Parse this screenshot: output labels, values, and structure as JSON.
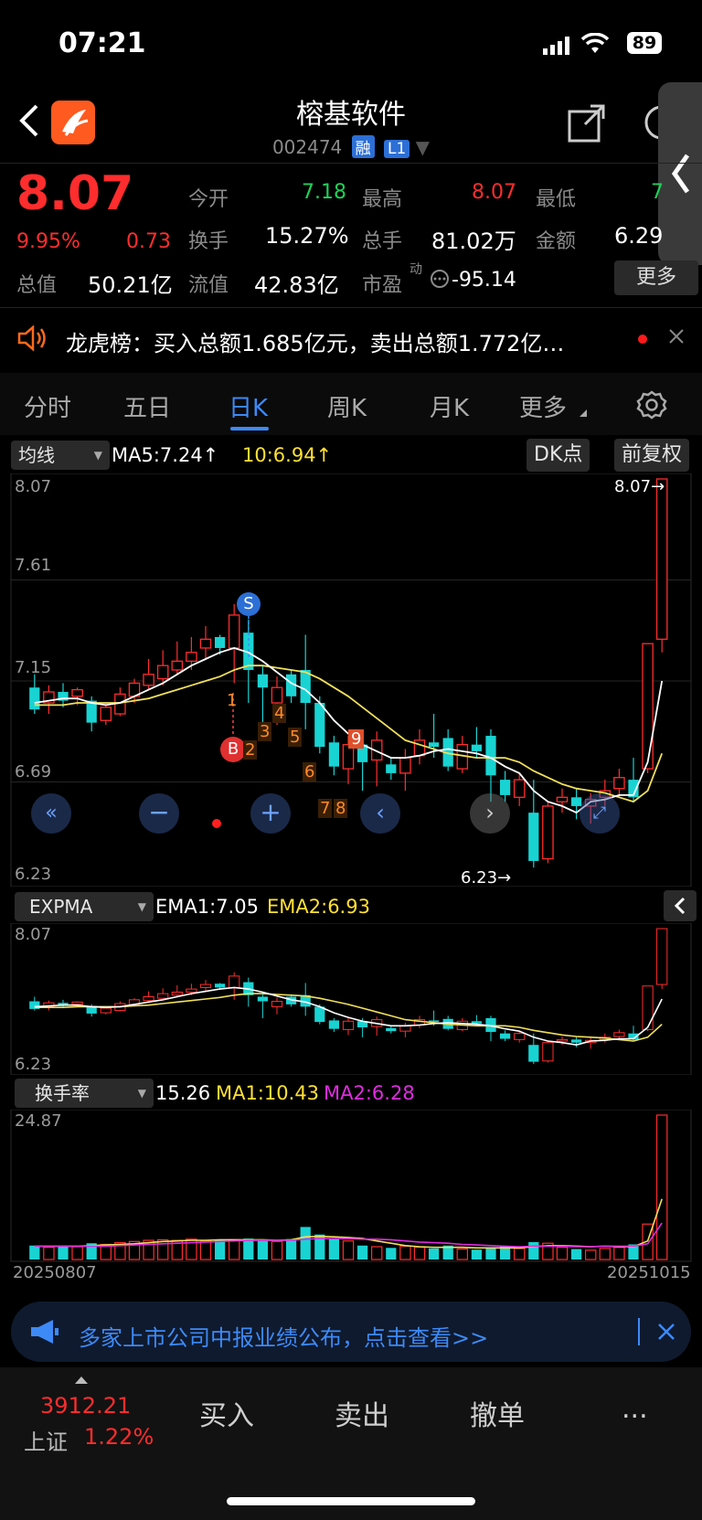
{
  "status_bar": {
    "time": "07:21",
    "battery": "89"
  },
  "header": {
    "title": "榕基软件",
    "code": "002474",
    "tag_rong": "融",
    "tag_l1": "L1",
    "back_icon": "chevron-left-icon",
    "share_icon": "share-icon",
    "search_icon": "search-icon",
    "side_tab_icon": "chevron-left-icon"
  },
  "quote": {
    "price": "8.07",
    "change_pct": "9.95%",
    "change": "0.73",
    "open_label": "今开",
    "open": "7.18",
    "high_label": "最高",
    "high": "8.07",
    "low_label": "最低",
    "low": "7",
    "turnover_label": "换手",
    "turnover": "15.27%",
    "volume_label": "总手",
    "volume": "81.02万",
    "amount_label": "金额",
    "amount": "6.29",
    "mcap_label": "总值",
    "mcap": "50.21亿",
    "float_label": "流值",
    "float": "42.83亿",
    "pe_label": "市盈",
    "pe_sup": "动",
    "pe": "-95.14",
    "more_label": "更多"
  },
  "news": {
    "text": "龙虎榜：买入总额1.685亿元，卖出总额1.772亿…",
    "speaker_icon": "speaker-icon",
    "close_icon": "close-icon"
  },
  "tabs": [
    {
      "label": "分时"
    },
    {
      "label": "五日"
    },
    {
      "label": "日K"
    },
    {
      "label": "周K"
    },
    {
      "label": "月K"
    },
    {
      "label": "更多"
    }
  ],
  "settings_icon": "gear-icon",
  "kline": {
    "ma_select": "均线",
    "ma5": "MA5:7.24↑",
    "ma10": "10:6.94↑",
    "dk_label": "DK点",
    "fq_label": "前复权",
    "y_labels": [
      "8.07",
      "7.61",
      "7.15",
      "6.69",
      "6.23"
    ],
    "max_label": "8.07→",
    "min_label": "6.23→",
    "signal_s": "S",
    "signal_b": "B",
    "counts": [
      "1",
      "2",
      "3",
      "4",
      "5",
      "6",
      "7",
      "8",
      "9"
    ]
  },
  "expma": {
    "select": "EXPMA",
    "ema1": "EMA1:7.05",
    "ema2": "EMA2:6.93",
    "y_top": "8.07",
    "y_bottom": "6.23"
  },
  "turnover_panel": {
    "select": "换手率",
    "value": "15.26",
    "ma1": "MA1:10.43",
    "ma2": "MA2:6.28",
    "y_top": "24.87",
    "date_start": "20250807",
    "date_end": "20251015"
  },
  "notice": {
    "text": "多家上市公司中报业绩公布，点击查看>>",
    "icon": "megaphone-icon",
    "close_icon": "close-icon"
  },
  "bottom": {
    "index_value": "3912.21",
    "index_name": "上证",
    "index_change": "1.22%",
    "buy": "买入",
    "sell": "卖出",
    "cancel": "撤单",
    "more": "..."
  },
  "colors": {
    "up": "#ff2d2d",
    "down": "#19d3d3",
    "accent": "#3d8af7",
    "ma5": "#ffffff",
    "ma10": "#f1e05a",
    "ma2": "#e02ce0"
  },
  "chart_data": {
    "type": "candlestick",
    "ylim": [
      6.23,
      8.07
    ],
    "candles": [
      [
        7.12,
        7.02,
        7.18,
        7.0
      ],
      [
        7.05,
        7.1,
        7.13,
        7.0
      ],
      [
        7.1,
        7.06,
        7.14,
        7.03
      ],
      [
        7.08,
        7.11,
        7.12,
        7.04
      ],
      [
        7.06,
        6.96,
        7.08,
        6.92
      ],
      [
        6.97,
        7.03,
        7.05,
        6.95
      ],
      [
        7.0,
        7.09,
        7.12,
        6.99
      ],
      [
        7.08,
        7.14,
        7.16,
        7.05
      ],
      [
        7.13,
        7.18,
        7.25,
        7.11
      ],
      [
        7.16,
        7.22,
        7.29,
        7.13
      ],
      [
        7.2,
        7.24,
        7.33,
        7.18
      ],
      [
        7.24,
        7.28,
        7.35,
        7.2
      ],
      [
        7.3,
        7.34,
        7.4,
        7.25
      ],
      [
        7.35,
        7.3,
        7.36,
        7.27
      ],
      [
        7.3,
        7.45,
        7.5,
        7.14
      ],
      [
        7.37,
        7.2,
        7.43,
        7.05
      ],
      [
        7.18,
        7.12,
        7.22,
        6.9
      ],
      [
        7.05,
        7.12,
        7.17,
        6.95
      ],
      [
        7.18,
        7.08,
        7.2,
        7.05
      ],
      [
        7.2,
        7.05,
        7.36,
        6.93
      ],
      [
        7.05,
        6.85,
        7.08,
        6.82
      ],
      [
        6.87,
        6.76,
        6.9,
        6.72
      ],
      [
        6.75,
        6.86,
        6.9,
        6.68
      ],
      [
        6.86,
        6.78,
        6.9,
        6.65
      ],
      [
        6.79,
        6.88,
        6.92,
        6.67
      ],
      [
        6.77,
        6.73,
        6.8,
        6.7
      ],
      [
        6.73,
        6.8,
        6.84,
        6.65
      ],
      [
        6.81,
        6.88,
        6.93,
        6.77
      ],
      [
        6.87,
        6.85,
        7.0,
        6.8
      ],
      [
        6.89,
        6.76,
        6.93,
        6.74
      ],
      [
        6.75,
        6.86,
        6.9,
        6.73
      ],
      [
        6.86,
        6.83,
        6.94,
        6.8
      ],
      [
        6.9,
        6.72,
        6.93,
        6.6
      ],
      [
        6.7,
        6.63,
        6.74,
        6.6
      ],
      [
        6.62,
        6.7,
        6.73,
        6.58
      ],
      [
        6.55,
        6.33,
        6.7,
        6.3
      ],
      [
        6.34,
        6.58,
        6.6,
        6.32
      ],
      [
        6.6,
        6.62,
        6.66,
        6.55
      ],
      [
        6.62,
        6.58,
        6.66,
        6.52
      ],
      [
        6.58,
        6.61,
        6.64,
        6.5
      ],
      [
        6.62,
        6.65,
        6.7,
        6.58
      ],
      [
        6.66,
        6.71,
        6.75,
        6.62
      ],
      [
        6.7,
        6.62,
        6.8,
        6.6
      ],
      [
        6.75,
        7.32,
        7.32,
        6.73
      ],
      [
        7.34,
        8.07,
        8.07,
        7.28
      ]
    ],
    "ma5": [
      7.05,
      7.06,
      7.07,
      7.07,
      7.05,
      7.04,
      7.05,
      7.08,
      7.11,
      7.14,
      7.18,
      7.22,
      7.25,
      7.28,
      7.3,
      7.28,
      7.24,
      7.19,
      7.14,
      7.11,
      7.05,
      6.97,
      6.91,
      6.86,
      6.83,
      6.8,
      6.8,
      6.81,
      6.83,
      6.84,
      6.83,
      6.82,
      6.8,
      6.76,
      6.73,
      6.65,
      6.6,
      6.58,
      6.55,
      6.6,
      6.61,
      6.63,
      6.63,
      6.78,
      7.15
    ],
    "ma10": [
      7.04,
      7.04,
      7.04,
      7.05,
      7.05,
      7.05,
      7.05,
      7.06,
      7.07,
      7.09,
      7.11,
      7.13,
      7.15,
      7.17,
      7.2,
      7.22,
      7.22,
      7.21,
      7.2,
      7.19,
      7.16,
      7.12,
      7.08,
      7.03,
      6.98,
      6.93,
      6.88,
      6.86,
      6.84,
      6.82,
      6.81,
      6.8,
      6.8,
      6.8,
      6.78,
      6.74,
      6.71,
      6.68,
      6.66,
      6.65,
      6.64,
      6.62,
      6.6,
      6.65,
      6.82
    ],
    "turnover": [
      2.4,
      2.1,
      2.3,
      2.2,
      2.8,
      2.6,
      2.9,
      3.1,
      3.3,
      3.4,
      3.3,
      3.5,
      3.2,
      3.4,
      3.4,
      3.6,
      3.2,
      3.1,
      3.5,
      5.6,
      4.3,
      3.5,
      3.2,
      2.4,
      2.2,
      2.0,
      2.3,
      2.1,
      1.9,
      2.4,
      1.8,
      1.7,
      2.0,
      2.3,
      1.9,
      3.0,
      2.8,
      2.1,
      1.8,
      1.6,
      1.9,
      2.1,
      2.6,
      6.1,
      24.87
    ],
    "turnover_ma1": [
      2.3,
      2.3,
      2.3,
      2.3,
      2.4,
      2.5,
      2.6,
      2.7,
      2.9,
      3.1,
      3.2,
      3.3,
      3.3,
      3.4,
      3.4,
      3.4,
      3.4,
      3.3,
      3.4,
      3.9,
      4.0,
      3.9,
      3.8,
      3.6,
      3.2,
      2.8,
      2.4,
      2.2,
      2.1,
      2.1,
      2.1,
      2.0,
      2.0,
      2.0,
      2.0,
      2.2,
      2.4,
      2.4,
      2.3,
      2.2,
      2.3,
      2.2,
      2.2,
      3.2,
      10.43
    ],
    "turnover_ma2": [
      2.3,
      2.3,
      2.3,
      2.3,
      2.3,
      2.3,
      2.4,
      2.5,
      2.6,
      2.7,
      2.8,
      2.9,
      3.0,
      3.1,
      3.2,
      3.3,
      3.3,
      3.3,
      3.3,
      3.5,
      3.6,
      3.6,
      3.6,
      3.5,
      3.5,
      3.4,
      3.2,
      3.0,
      2.9,
      2.8,
      2.6,
      2.5,
      2.4,
      2.3,
      2.2,
      2.3,
      2.3,
      2.3,
      2.2,
      2.2,
      2.3,
      2.3,
      2.3,
      2.7,
      6.28
    ]
  }
}
